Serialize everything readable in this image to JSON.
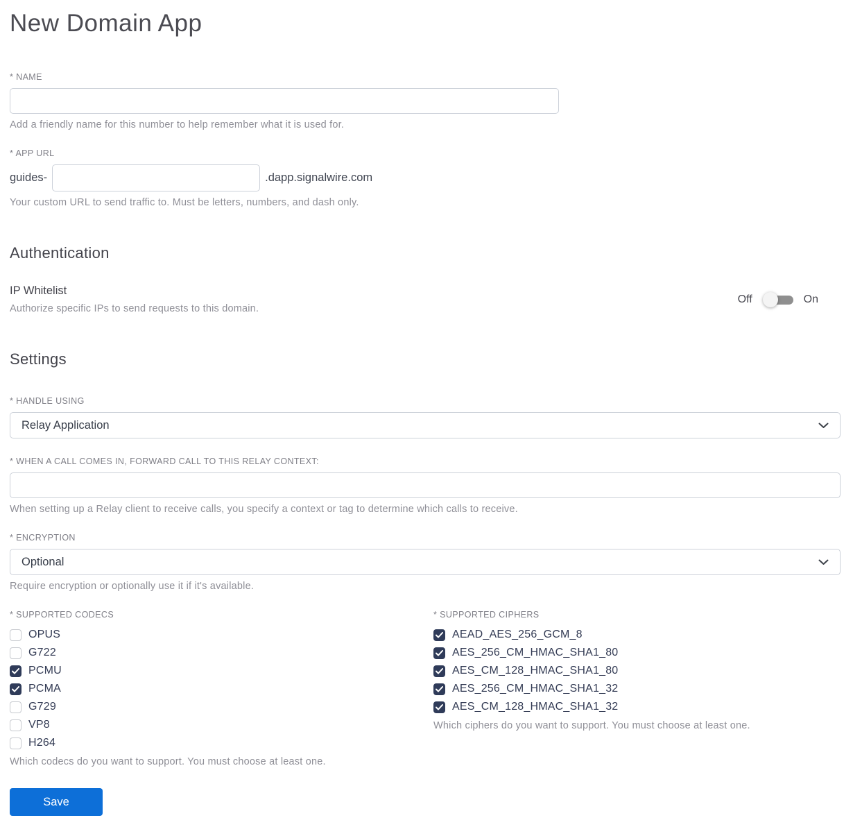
{
  "page": {
    "title": "New Domain App"
  },
  "fields": {
    "name": {
      "label": "* NAME",
      "value": "",
      "helper": "Add a friendly name for this number to help remember what it is used for."
    },
    "app_url": {
      "label": "* APP URL",
      "prefix": "guides-",
      "value": "",
      "suffix": ".dapp.signalwire.com",
      "helper": "Your custom URL to send traffic to. Must be letters, numbers, and dash only."
    }
  },
  "authentication": {
    "title": "Authentication",
    "ip_whitelist": {
      "label": "IP Whitelist",
      "helper": "Authorize specific IPs to send requests to this domain.",
      "off_label": "Off",
      "on_label": "On",
      "state": "off"
    }
  },
  "settings": {
    "title": "Settings",
    "handle_using": {
      "label": "* HANDLE USING",
      "value": "Relay Application"
    },
    "relay_context": {
      "label": "* WHEN A CALL COMES IN, FORWARD CALL TO THIS RELAY CONTEXT:",
      "value": "",
      "helper": "When setting up a Relay client to receive calls, you specify a context or tag to determine which calls to receive."
    },
    "encryption": {
      "label": "* ENCRYPTION",
      "value": "Optional",
      "helper": "Require encryption or optionally use it if it's available."
    },
    "codecs": {
      "label": "* SUPPORTED CODECS",
      "helper": "Which codecs do you want to support. You must choose at least one.",
      "options": [
        {
          "label": "OPUS",
          "checked": false
        },
        {
          "label": "G722",
          "checked": false
        },
        {
          "label": "PCMU",
          "checked": true
        },
        {
          "label": "PCMA",
          "checked": true
        },
        {
          "label": "G729",
          "checked": false
        },
        {
          "label": "VP8",
          "checked": false
        },
        {
          "label": "H264",
          "checked": false
        }
      ]
    },
    "ciphers": {
      "label": "* SUPPORTED CIPHERS",
      "helper": "Which ciphers do you want to support. You must choose at least one.",
      "options": [
        {
          "label": "AEAD_AES_256_GCM_8",
          "checked": true
        },
        {
          "label": "AES_256_CM_HMAC_SHA1_80",
          "checked": true
        },
        {
          "label": "AES_CM_128_HMAC_SHA1_80",
          "checked": true
        },
        {
          "label": "AES_256_CM_HMAC_SHA1_32",
          "checked": true
        },
        {
          "label": "AES_CM_128_HMAC_SHA1_32",
          "checked": true
        }
      ]
    }
  },
  "actions": {
    "save_label": "Save"
  },
  "colors": {
    "primary_button": "#0d6fd8",
    "checkbox_checked": "#2f3b59",
    "toggle_track": "#8f8f8f",
    "toggle_knob": "#f4f4f4",
    "label_gray": "#7e7e86",
    "helper_gray": "#8f8f97",
    "input_border": "#ccd1d9"
  }
}
